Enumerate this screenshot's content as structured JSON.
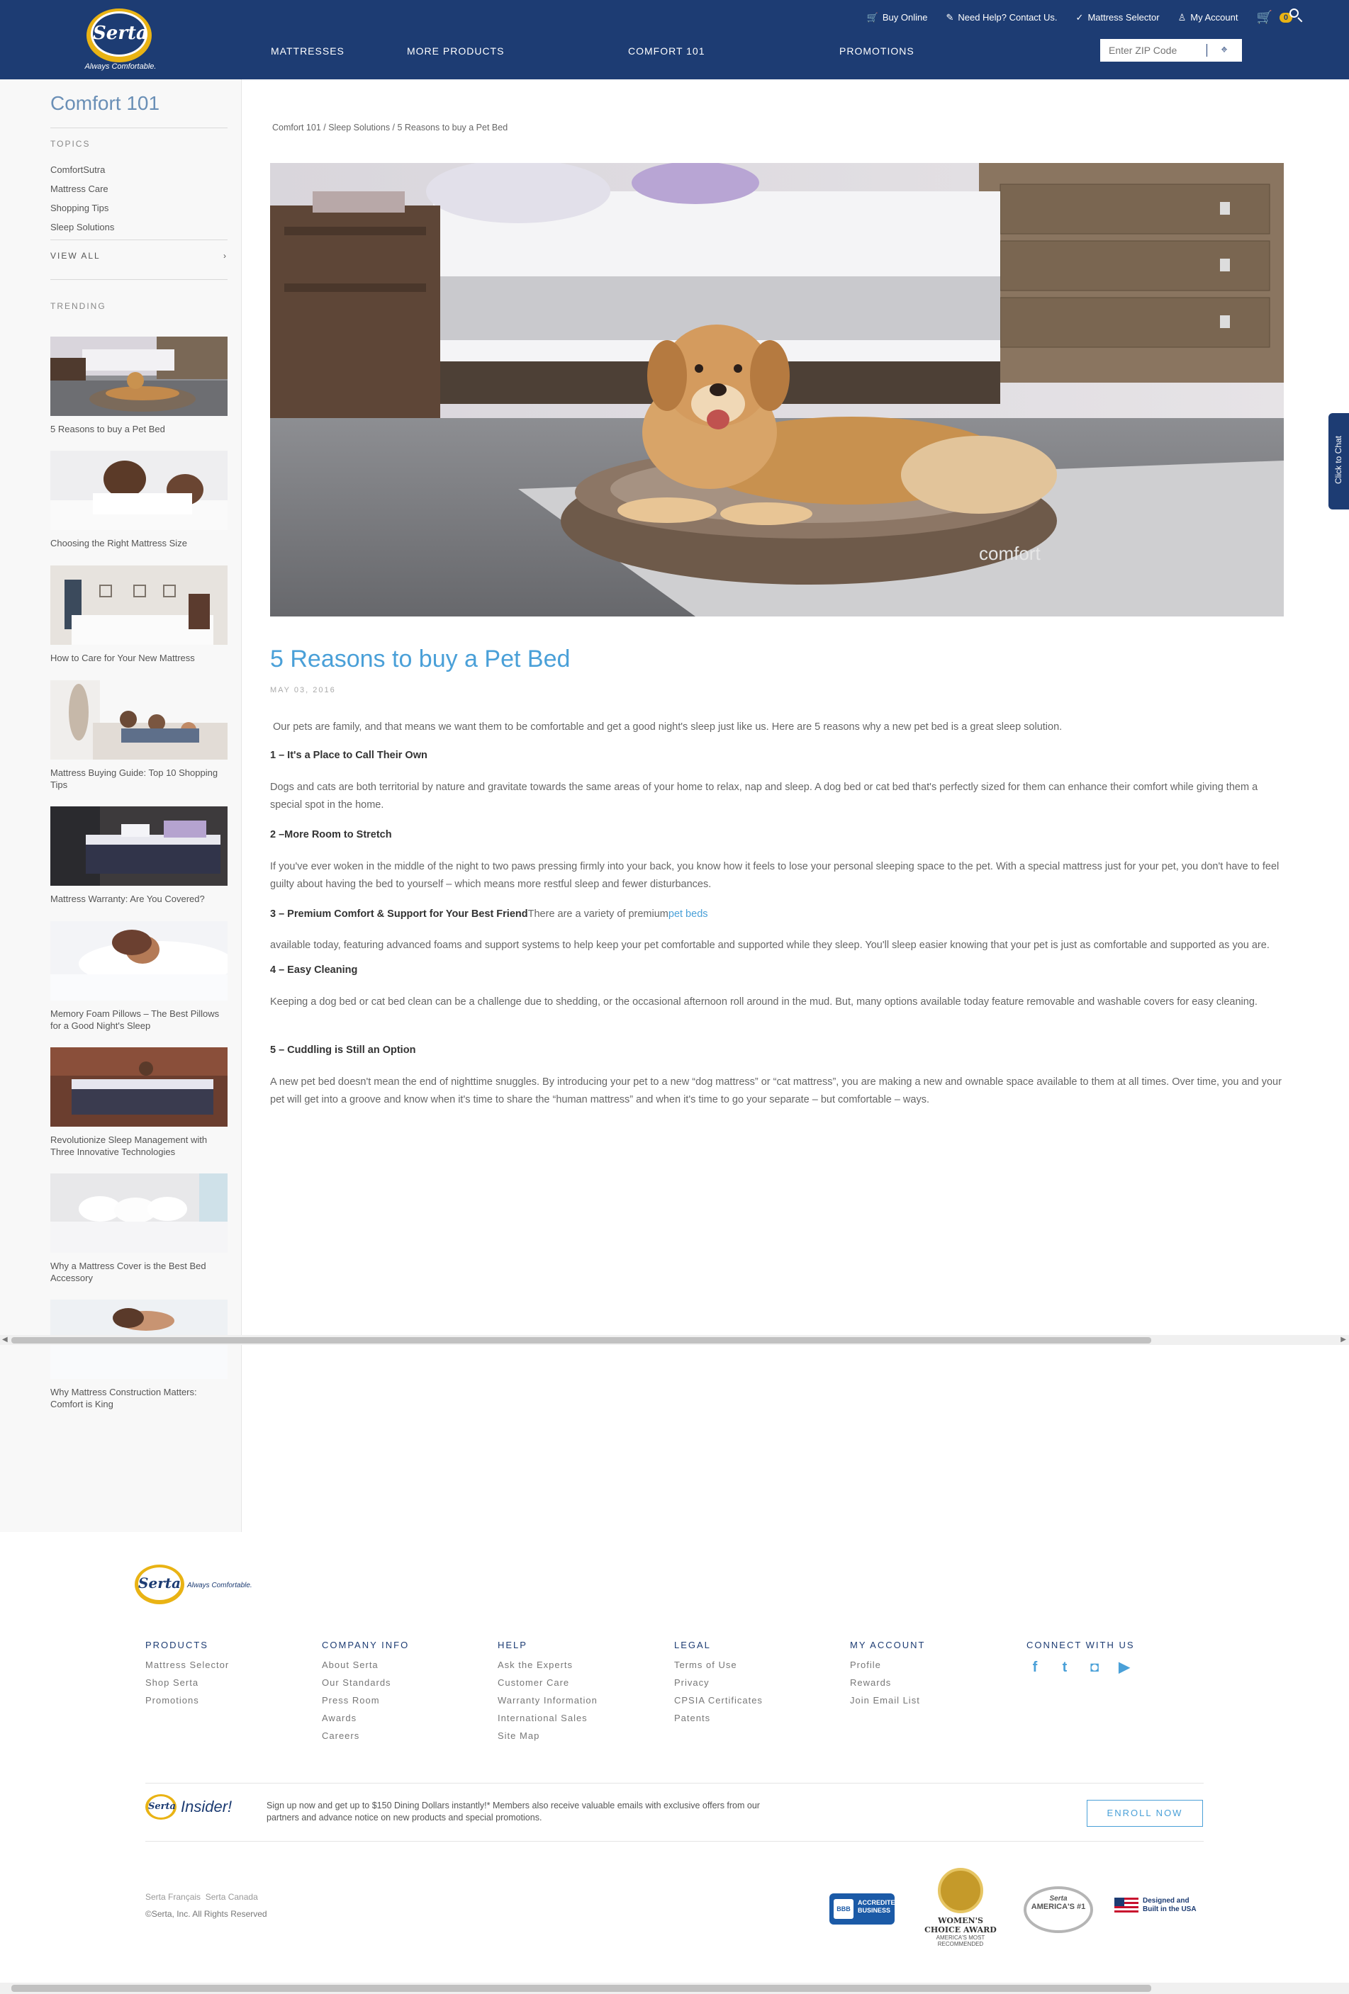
{
  "header": {
    "logo_text": "Serta",
    "logo_tagline": "Always Comfortable.",
    "utility": [
      {
        "label": "Buy Online",
        "icon": "cart-icon"
      },
      {
        "label": "Need Help? Contact Us.",
        "icon": "link-icon"
      },
      {
        "label": "Mattress Selector",
        "icon": "check-circle-icon"
      },
      {
        "label": "My Account",
        "icon": "user-icon"
      }
    ],
    "cart_count": "0",
    "nav": [
      "MATTRESSES",
      "MORE PRODUCTS",
      "COMFORT 101",
      "PROMOTIONS"
    ],
    "zip_placeholder": "Enter ZIP Code"
  },
  "sidebar": {
    "title": "Comfort 101",
    "topics_label": "TOPICS",
    "topics": [
      "ComfortSutra",
      "Mattress Care",
      "Shopping Tips",
      "Sleep Solutions"
    ],
    "view_all": "VIEW ALL",
    "trending_label": "TRENDING",
    "trending": [
      "5 Reasons to buy a Pet Bed",
      "Choosing the Right Mattress Size",
      "How to Care for Your New Mattress",
      "Mattress Buying Guide: Top 10 Shopping Tips",
      "Mattress Warranty: Are You Covered?",
      "Memory Foam Pillows – The Best Pillows for a Good Night's Sleep",
      "Revolutionize Sleep Management with Three Innovative Technologies",
      "Why a Mattress Cover is the Best Bed Accessory",
      "Why Mattress Construction Matters: Comfort is King"
    ]
  },
  "article": {
    "breadcrumb": "Comfort 101 / Sleep Solutions / 5 Reasons to buy a Pet Bed",
    "hero_brand": "comfort",
    "title": "5 Reasons to buy a Pet Bed",
    "date": "MAY 03, 2016",
    "intro": "Our pets are family, and that means we want them to be comfortable and get a good night's sleep just like us. Here are 5 reasons why a new pet bed is a great sleep solution.",
    "h1": "1 – It's a Place to Call Their Own",
    "p1": "Dogs and cats are both territorial by nature and gravitate towards the same areas of your home to relax, nap and sleep. A dog bed or cat bed that's perfectly sized for them can enhance their comfort while giving them a special spot in the home.",
    "h2": "2 –More Room to Stretch",
    "p2": "If you've ever woken in the middle of the night to two paws pressing firmly into your back, you know how it feels to lose your personal sleeping space to the pet. With a special mattress just for your pet, you don't have to feel guilty about having the bed to yourself – which means more restful sleep and fewer disturbances.",
    "h3": "3 – Premium Comfort & Support for Your Best Friend",
    "h3_after": "There are a variety of premium",
    "h3_link": "pet beds",
    "p3": "available today, featuring advanced foams and support systems to help keep your pet comfortable and supported while they sleep. You'll sleep easier knowing that your pet is just as comfortable and supported as you are.",
    "h4": "4 – Easy Cleaning",
    "p4": "Keeping a dog bed or cat bed clean can be a challenge due to shedding, or the occasional afternoon roll around in the mud. But, many options available today feature removable and washable covers for easy cleaning.",
    "h5": "5 – Cuddling is Still an Option",
    "p5": "A new pet bed doesn't mean the end of nighttime snuggles. By introducing your pet to a new “dog mattress” or “cat mattress”, you are making a new and ownable space available to them at all times. Over time, you and your pet will get into a groove and know when it's time to share the “human mattress” and when it's time to go your separate – but comfortable – ways."
  },
  "chat_label": "Click to Chat",
  "footer": {
    "logo_text": "Serta",
    "logo_tagline": "Always Comfortable.",
    "columns": [
      {
        "title": "PRODUCTS",
        "items": [
          "Mattress Selector",
          "Shop Serta",
          "Promotions"
        ]
      },
      {
        "title": "COMPANY INFO",
        "items": [
          "About Serta",
          "Our Standards",
          "Press Room",
          "Awards",
          "Careers"
        ]
      },
      {
        "title": "HELP",
        "items": [
          "Ask the Experts",
          "Customer Care",
          "Warranty Information",
          "International Sales",
          "Site Map"
        ]
      },
      {
        "title": "LEGAL",
        "items": [
          "Terms of Use",
          "Privacy",
          "CPSIA Certificates",
          "Patents"
        ]
      },
      {
        "title": "MY ACCOUNT",
        "items": [
          "Profile",
          "Rewards",
          "Join Email List"
        ]
      }
    ],
    "connect_title": "CONNECT WITH US",
    "social": [
      "facebook-icon",
      "twitter-icon",
      "instagram-icon",
      "youtube-icon"
    ],
    "insider_logo": "Serta",
    "insider_word": "Insider!",
    "insider_text": "Sign up now and get up to $150 Dining Dollars instantly!* Members also receive valuable emails with exclusive offers from our partners and advance notice on new products and special promotions.",
    "enroll": "ENROLL NOW",
    "lang_1": "Serta Français",
    "lang_2": "Serta Canada",
    "copyright": "©Serta, Inc. All Rights Reserved",
    "bbb_1": "ACCREDITED",
    "bbb_2": "BUSINESS",
    "bbb_logo": "BBB",
    "wca_title": "WOMEN'S CHOICE AWARD",
    "wca_sub": "AMERICA'S MOST RECOMMENDED",
    "a1_text": "AMERICA'S #1",
    "a1_brand": "Serta",
    "usa_1": "Designed and",
    "usa_2": "Built in the USA"
  },
  "colors": {
    "brand_navy": "#1d3c73",
    "accent_gold": "#e9b314",
    "link_blue": "#4aa0d8"
  }
}
